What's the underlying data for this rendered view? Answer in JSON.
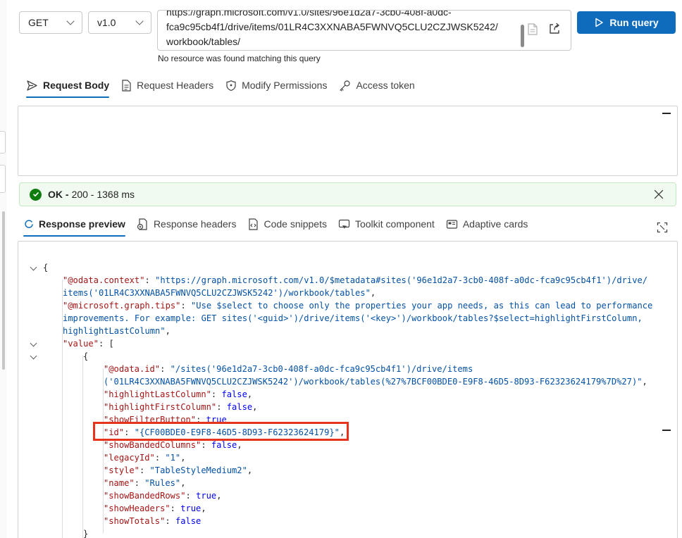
{
  "toolbar": {
    "method": "GET",
    "version": "v1.0",
    "url_line0": "https://graph.microsoft.com/v1.0/sites/96e1d2a7-3cb0-408f-a0dc-",
    "url_line1": "fca9c95cb4f1/drive/items/01LR4C3XXNABA5FWNVQ5CLU2CZJWSK5242/",
    "url_line2": "workbook/tables/",
    "run_label": "Run query",
    "status_message": "No resource was found matching this query"
  },
  "request_tabs": [
    {
      "label": "Request Body",
      "icon": "send-icon"
    },
    {
      "label": "Request Headers",
      "icon": "document-icon"
    },
    {
      "label": "Modify Permissions",
      "icon": "shield-icon"
    },
    {
      "label": "Access token",
      "icon": "key-icon"
    }
  ],
  "response_status": {
    "ok": "OK -",
    "detail": "200 - 1368 ms"
  },
  "response_tabs": [
    {
      "label": "Response preview",
      "icon": "preview-icon"
    },
    {
      "label": "Response headers",
      "icon": "headers-icon"
    },
    {
      "label": "Code snippets",
      "icon": "code-icon"
    },
    {
      "label": "Toolkit component",
      "icon": "toolkit-icon"
    },
    {
      "label": "Adaptive cards",
      "icon": "card-icon"
    }
  ],
  "response_json": {
    "l0": "{",
    "l1_key": "\"@odata.context\"",
    "l1_val": "\"https://graph.microsoft.com/v1.0/$metadata#sites('96e1d2a7-3cb0-408f-a0dc-fca9c95cb4f1')/drive/",
    "l2_val": "items('01LR4C3XXNABA5FWNVQ5CLU2CZJWSK5242')/workbook/tables\"",
    "l3_key": "\"@microsoft.graph.tips\"",
    "l3_val": "\"Use $select to choose only the properties your app needs, as this can lead to performance",
    "l4_val": "improvements. For example: GET sites('<guid>')/drive/items('<key>')/workbook/tables?$select=highlightFirstColumn,",
    "l5_val": "highlightLastColumn\"",
    "l6_key": "\"value\"",
    "l6_val": "[",
    "l7": "{",
    "l8_key": "\"@odata.id\"",
    "l8_val": "\"/sites('96e1d2a7-3cb0-408f-a0dc-fca9c95cb4f1')/drive/items",
    "l9_val": "('01LR4C3XXNABA5FWNVQ5CLU2CZJWSK5242')/workbook/tables(%27%7BCF00BDE0-E9F8-46D5-8D93-F62323624179%7D%27)\"",
    "l10_key": "\"highlightLastColumn\"",
    "l10_val": "false",
    "l11_key": "\"highlightFirstColumn\"",
    "l11_val": "false",
    "l12_key": "\"showFilterButton\"",
    "l12_val": "true",
    "l13_key": "\"id\"",
    "l13_val": "\"{CF00BDE0-E9F8-46D5-8D93-F62323624179}\"",
    "l14_key": "\"showBandedColumns\"",
    "l14_val": "false",
    "l15_key": "\"legacyId\"",
    "l15_val": "\"1\"",
    "l16_key": "\"style\"",
    "l16_val": "\"TableStyleMedium2\"",
    "l17_key": "\"name\"",
    "l17_val": "\"Rules\"",
    "l18_key": "\"showBandedRows\"",
    "l18_val": "true",
    "l19_key": "\"showHeaders\"",
    "l19_val": "true",
    "l20_key": "\"showTotals\"",
    "l20_val": "false",
    "l21": "}"
  },
  "colors": {
    "accent": "#0f6cbd",
    "success": "#107c10",
    "highlight_border": "#e8341c",
    "json_key": "#a31515",
    "json_string": "#0451a5",
    "json_bool": "#0000ff"
  }
}
